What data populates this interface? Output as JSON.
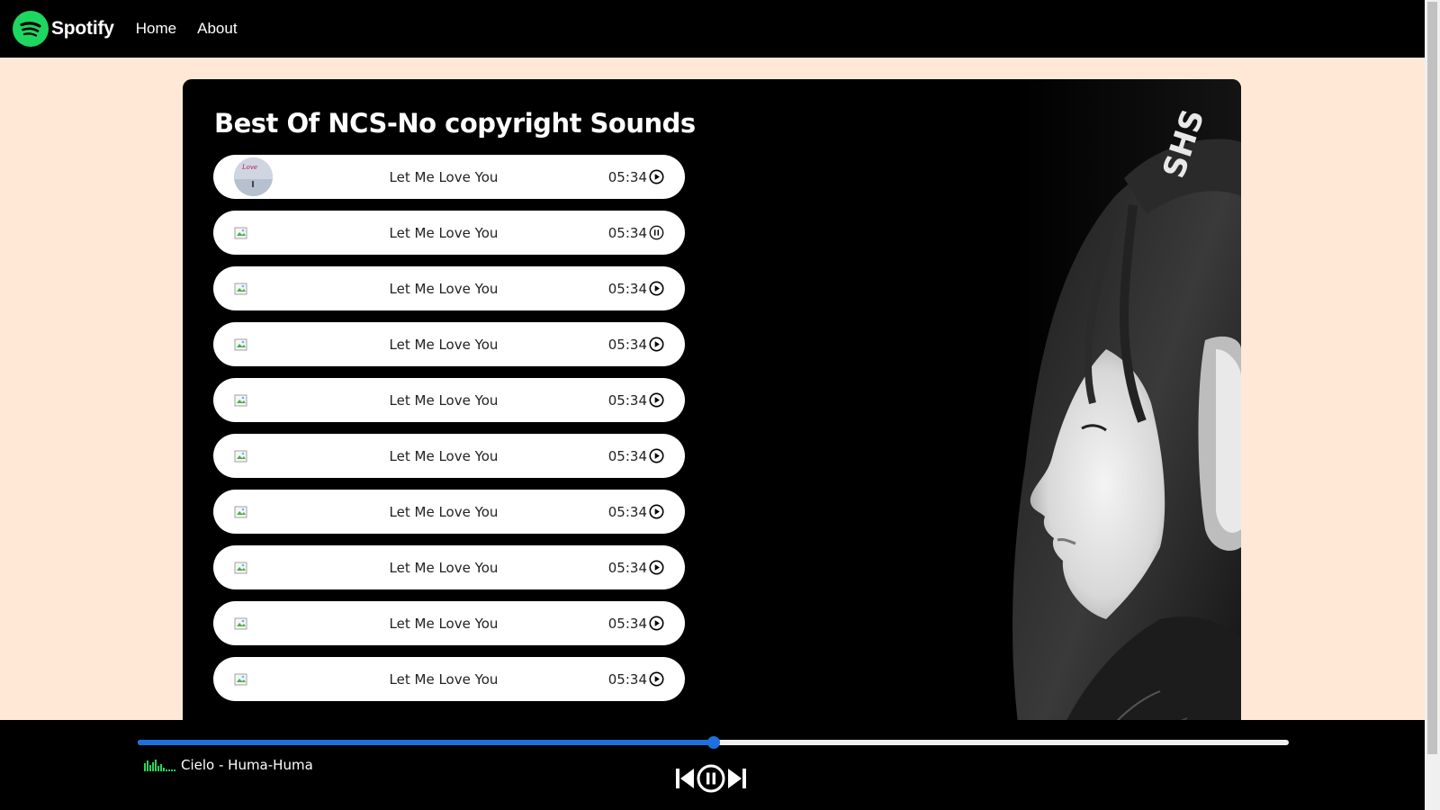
{
  "nav": {
    "brand": "Spotify",
    "links": [
      "Home",
      "About"
    ]
  },
  "playlist": {
    "title": "Best Of NCS-No copyright Sounds",
    "songs": [
      {
        "name": "Let Me Love You",
        "duration": "05:34",
        "state": "play"
      },
      {
        "name": "Let Me Love You",
        "duration": "05:34",
        "state": "pause"
      },
      {
        "name": "Let Me Love You",
        "duration": "05:34",
        "state": "play"
      },
      {
        "name": "Let Me Love You",
        "duration": "05:34",
        "state": "play"
      },
      {
        "name": "Let Me Love You",
        "duration": "05:34",
        "state": "play"
      },
      {
        "name": "Let Me Love You",
        "duration": "05:34",
        "state": "play"
      },
      {
        "name": "Let Me Love You",
        "duration": "05:34",
        "state": "play"
      },
      {
        "name": "Let Me Love You",
        "duration": "05:34",
        "state": "play"
      },
      {
        "name": "Let Me Love You",
        "duration": "05:34",
        "state": "play"
      },
      {
        "name": "Let Me Love You",
        "duration": "05:34",
        "state": "play"
      }
    ]
  },
  "player": {
    "now_playing": "Cielo - Huma-Huma",
    "progress_fraction": 0.5,
    "controls": [
      "previous-icon",
      "pause-icon",
      "next-icon"
    ]
  },
  "colors": {
    "accent_green": "#1ed760",
    "progress_blue": "#1f6fe0",
    "page_bg": "#ffe9d6"
  }
}
